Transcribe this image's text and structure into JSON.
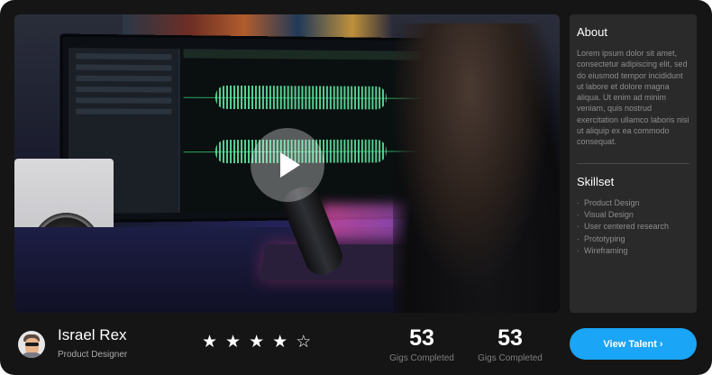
{
  "about": {
    "title": "About",
    "text": "Lorem ipsum dolor sit amet, consectetur adipiscing elit, sed do eiusmod tempor incididunt ut labore et dolore magna aliqua. Ut enim ad minim veniam, quis nostrud exercitation ullamco laboris nisi ut aliquip ex ea commodo consequat."
  },
  "skillset": {
    "title": "Skillset",
    "items": [
      "Product Design",
      "Visual Design",
      "User centered research",
      "Prototyping",
      "Wireframing"
    ]
  },
  "profile": {
    "name": "Israel Rex",
    "role": "Product Designer",
    "rating": {
      "value": 4,
      "max": 5,
      "filled_glyph": "★",
      "empty_glyph": "☆"
    }
  },
  "stats": [
    {
      "value": "53",
      "label": "Gigs Completed"
    },
    {
      "value": "53",
      "label": "Gigs Completed"
    }
  ],
  "cta": {
    "label": "View Talent",
    "icon": "chevron-right-icon",
    "chevron": "›",
    "color": "#1aa5f6"
  },
  "video": {
    "play_icon": "play-icon"
  }
}
